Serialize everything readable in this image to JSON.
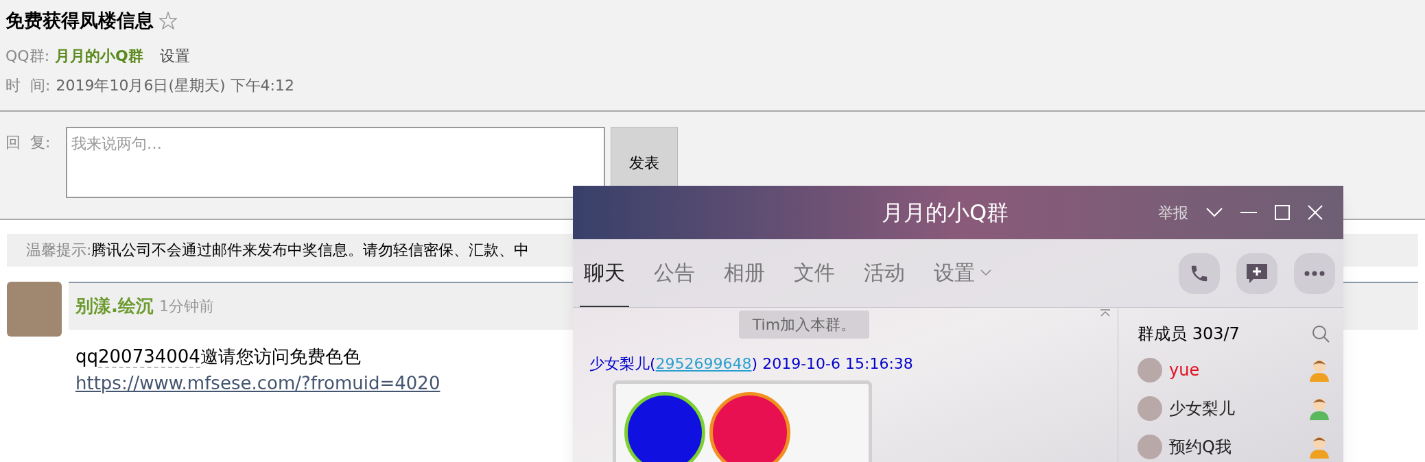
{
  "post": {
    "title": "免费获得凤楼信息",
    "starred": false,
    "group_label": "QQ群:",
    "group_name": "月月的小Q群",
    "settings_link": "设置",
    "time_label": "时  间:",
    "time_value": "2019年10月6日(星期天) 下午4:12"
  },
  "reply": {
    "label": "回  复:",
    "placeholder": "我来说两句…",
    "submit": "发表"
  },
  "tip": {
    "label": "温馨提示:",
    "text": "腾讯公司不会通过邮件来发布中奖信息。请勿轻信密保、汇款、中"
  },
  "comment": {
    "author": "别漾.绘沉",
    "time": "1分钟前",
    "text_prefix": "qq",
    "text_number": "200734004",
    "text_rest": "邀请您访问免费色色",
    "link": "https://www.mfsese.com/?fromuid=4020"
  },
  "chat_window": {
    "title": "月月的小Q群",
    "report": "举报",
    "tabs": [
      {
        "label": "聊天",
        "selected": true,
        "dropdown": false
      },
      {
        "label": "公告",
        "selected": false,
        "dropdown": false
      },
      {
        "label": "相册",
        "selected": false,
        "dropdown": false
      },
      {
        "label": "文件",
        "selected": false,
        "dropdown": false
      },
      {
        "label": "活动",
        "selected": false,
        "dropdown": false
      },
      {
        "label": "设置",
        "selected": false,
        "dropdown": true
      }
    ],
    "system_notice": "Tim加入本群。",
    "message": {
      "sender": "少女梨儿(",
      "sender_id": "2952699648",
      "sender_close": ")",
      "time": "2019-10-6 15:16:38"
    },
    "members_title": "群成员 303/7",
    "members": [
      {
        "name": "yue",
        "highlighted": true,
        "color": "#f0a020"
      },
      {
        "name": "少女梨儿",
        "highlighted": false,
        "color": "#5cb85c"
      },
      {
        "name": "预约Q我",
        "highlighted": false,
        "color": "#f0a020"
      }
    ]
  }
}
